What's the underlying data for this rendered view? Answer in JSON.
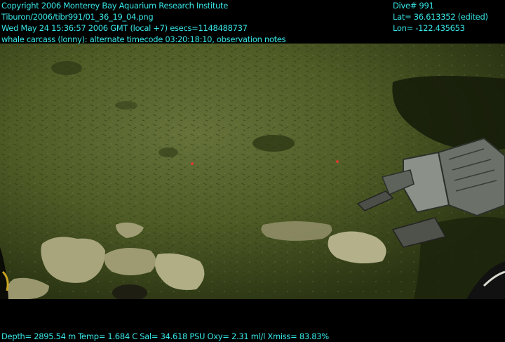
{
  "overlay": {
    "top_left": [
      "Copyright 2006 Monterey Bay Aquarium Research Institute",
      "Tiburon/2006/tibr991/01_36_19_04.png",
      "Wed May 24 15:36:57 2006 GMT (local +7)  esecs=1148488737",
      "whale carcass (lonny): alternate timecode 03:20:18:10, observation notes"
    ],
    "top_right": [
      "Dive# 991",
      "Lat= 36.613352 (edited)",
      "Lon= -122.435653"
    ],
    "bottom": "Depth= 2895.54 m  Temp= 1.684 C  Sal= 34.618 PSU  Oxy= 2.31 ml/l  Xmiss= 83.83%"
  },
  "colors": {
    "overlay_text": "#39e6e6",
    "seafloor": "#4c5a24",
    "background": "#000000"
  }
}
